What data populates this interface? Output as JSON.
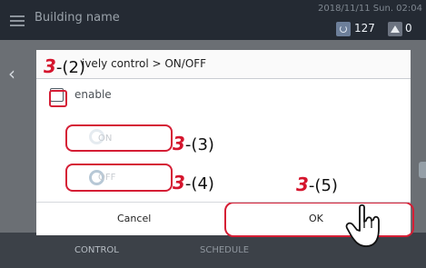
{
  "header": {
    "building_name": "Building name",
    "datetime": "2018/11/11 Sun. 02:04",
    "power_count": "127",
    "alarm_count": "0",
    "menu_icon": "hamburger-menu-icon",
    "power_icon": "power-icon",
    "alarm_icon": "warning-icon"
  },
  "dialog": {
    "title": "ively control > ON/OFF",
    "enable_label": "enable",
    "on_label": "ON",
    "off_label": "OFF",
    "cancel_label": "Cancel",
    "ok_label": "OK"
  },
  "annotations": {
    "item_2": {
      "num": "3",
      "label": "-(2)"
    },
    "item_3": {
      "num": "3",
      "label": "-(3)"
    },
    "item_4": {
      "num": "3",
      "label": "-(4)"
    },
    "item_5": {
      "num": "3",
      "label": "-(5)"
    }
  },
  "bottom_tabs": {
    "control": "CONTROL",
    "schedule": "SCHEDULE"
  },
  "colors": {
    "highlight_red": "#d51e35",
    "topbar": "#242a33",
    "overlay": "#6b6f74"
  }
}
